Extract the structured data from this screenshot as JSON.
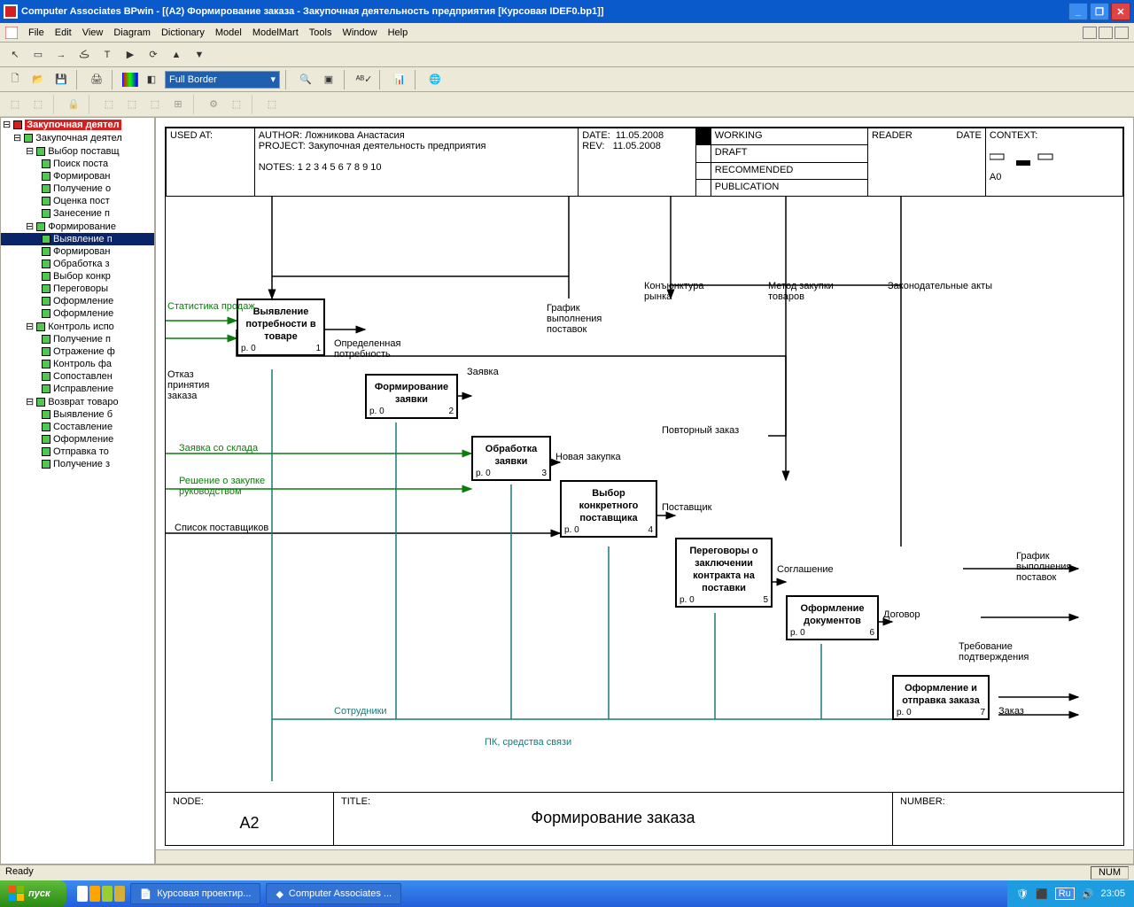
{
  "window": {
    "title": "Computer Associates BPwin - [(A2) Формирование  заказа - Закупочная деятельность предприятия  [Курсовая IDEF0.bp1]]"
  },
  "menu": {
    "file": "File",
    "edit": "Edit",
    "view": "View",
    "diagram": "Diagram",
    "dictionary": "Dictionary",
    "model": "Model",
    "modelmart": "ModelMart",
    "tools": "Tools",
    "window": "Window",
    "help": "Help"
  },
  "toolbar": {
    "border_mode": "Full Border"
  },
  "tree": {
    "root": "Закупочная деятел",
    "n1": "Закупочная деятел",
    "n1_1": "Выбор поставщ",
    "n1_1_1": "Поиск поста",
    "n1_1_2": "Формирован",
    "n1_1_3": "Получение о",
    "n1_1_4": "Оценка пост",
    "n1_1_5": "Занесение п",
    "n1_2": "Формирование",
    "n1_2_1": "Выявление п",
    "n1_2_2": "Формирован",
    "n1_2_3": "Обработка з",
    "n1_2_4": "Выбор конкр",
    "n1_2_5": "Переговоры",
    "n1_2_6": "Оформление",
    "n1_2_7": "Оформление",
    "n1_3": "Контроль испо",
    "n1_3_1": "Получение п",
    "n1_3_2": "Отражение ф",
    "n1_3_3": "Контроль фа",
    "n1_3_4": "Сопоставлен",
    "n1_3_5": "Исправление",
    "n1_4": "Возврат товаро",
    "n1_4_1": "Выявление б",
    "n1_4_2": "Составление",
    "n1_4_3": "Оформление",
    "n1_4_4": "Отправка то",
    "n1_4_5": "Получение з"
  },
  "diagram_header": {
    "used_at": "USED AT:",
    "author_lbl": "AUTHOR:",
    "author": "Ложникова Анастасия",
    "project_lbl": "PROJECT:",
    "project": "Закупочная деятельность предприятия",
    "notes_lbl": "NOTES:",
    "notes": "1  2  3  4  5  6  7  8  9  10",
    "date_lbl": "DATE:",
    "date": "11.05.2008",
    "rev_lbl": "REV:",
    "rev": "11.05.2008",
    "working": "WORKING",
    "draft": "DRAFT",
    "recommended": "RECOMMENDED",
    "publication": "PUBLICATION",
    "reader": "READER",
    "rdate": "DATE",
    "context": "CONTEXT:",
    "context_a": "A0"
  },
  "boxes": {
    "b1": {
      "title": "Выявление потребности в товаре",
      "p": "p. 0",
      "i": "1"
    },
    "b2": {
      "title": "Формирование заявки",
      "p": "p. 0",
      "i": "2"
    },
    "b3": {
      "title": "Обработка заявки",
      "p": "p. 0",
      "i": "3"
    },
    "b4": {
      "title": "Выбор конкретного поставщика",
      "p": "p. 0",
      "i": "4"
    },
    "b5": {
      "title": "Переговоры о заключении контракта на поставки",
      "p": "p. 0",
      "i": "5"
    },
    "b6": {
      "title": "Оформление документов",
      "p": "p. 0",
      "i": "6"
    },
    "b7": {
      "title": "Оформление и отправка заказа",
      "p": "p. 0",
      "i": "7"
    }
  },
  "labels": {
    "stat_prodazh": "Статистика продаж",
    "otkaz": "Отказ принятия заказа",
    "opred": "Определенная потребность",
    "zayavka": "Заявка",
    "zayavka_sklad": "Заявка со склада",
    "reshenie": "Решение о закупке руководством",
    "spisok": "Список поставщиков",
    "grafik": "График выполнения поставок",
    "konyun": "Конъюнктура рынка",
    "metod": "Метод закупки товаров",
    "zakon": "Законодательные акты",
    "povtor": "Повторный заказ",
    "novaya": "Новая закупка",
    "postav": "Поставщик",
    "soglash": "Соглашение",
    "dogovor": "Договор",
    "treb": "Требование подтверждения",
    "zakaz": "Заказ",
    "grafik2": "График выполнения поставок",
    "sotrud": "Сотрудники",
    "pk": "ПК, средства связи"
  },
  "footer": {
    "node_lbl": "NODE:",
    "node": "A2",
    "title_lbl": "TITLE:",
    "title": "Формирование  заказа",
    "number_lbl": "NUMBER:"
  },
  "status": {
    "ready": "Ready",
    "num": "NUM"
  },
  "taskbar": {
    "start": "пуск",
    "task1": "Курсовая проектир...",
    "task2": "Computer Associates ...",
    "lang": "Ru",
    "time": "23:05"
  }
}
